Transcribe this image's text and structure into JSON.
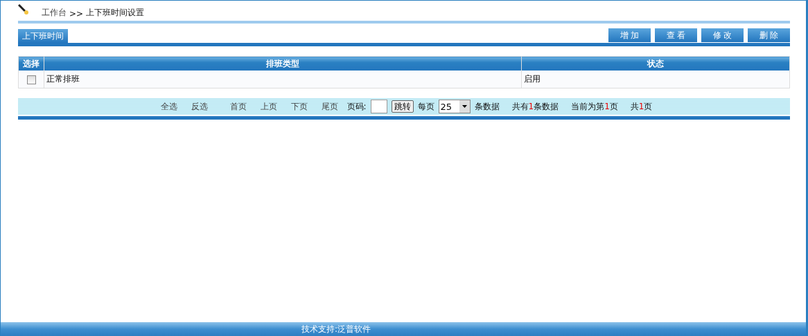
{
  "breadcrumb": {
    "home": "工作台",
    "separator": ">>",
    "current": "上下班时间设置"
  },
  "section_tab": "上下班时间",
  "actions": [
    "增 加",
    "查 看",
    "修 改",
    "删 除"
  ],
  "table": {
    "columns": [
      "选择",
      "排班类型",
      "状态"
    ],
    "rows": [
      {
        "checked": false,
        "type": "正常排班",
        "status": "启用"
      }
    ]
  },
  "pager": {
    "links": [
      "全选",
      "反选",
      "首页",
      "上页",
      "下页",
      "尾页"
    ],
    "page_label": "页码:",
    "go": "跳转",
    "per_page_label": "每页",
    "per_page": "25",
    "per_page_suffix": "条数据",
    "info": [
      {
        "before": "共有",
        "count": "1",
        "after": "条数据"
      },
      {
        "before": "当前为第",
        "count": "1",
        "after": "页"
      },
      {
        "before": "共",
        "count": "1",
        "after": "页"
      }
    ]
  },
  "footer": "技术支持:泛普软件"
}
